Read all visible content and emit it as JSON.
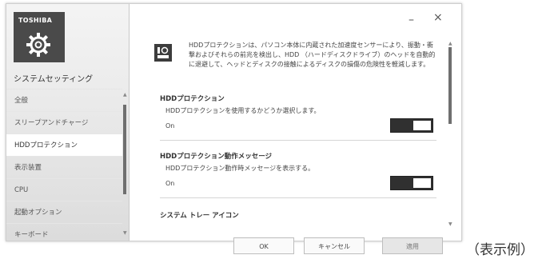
{
  "sidebar": {
    "brand": "TOSHIBA",
    "app_name": "システムセッティング",
    "items": [
      {
        "label": "全般"
      },
      {
        "label": "スリープアンドチャージ"
      },
      {
        "label": "HDDプロテクション",
        "selected": true
      },
      {
        "label": "表示装置"
      },
      {
        "label": "CPU"
      },
      {
        "label": "起動オプション"
      },
      {
        "label": "キーボード"
      }
    ]
  },
  "window_controls": {
    "minimize": "–",
    "close": "×"
  },
  "main": {
    "description": "HDDプロテクションは、パソコン本体に内蔵された加速度センサーにより、振動・衝撃およびそれらの前兆を検出し、HDD （ハードディスクドライブ）のヘッドを自動的に退避して、ヘッドとディスクの接触によるディスクの損傷の危険性を軽減します。",
    "sections": [
      {
        "title": "HDDプロテクション",
        "desc": "HDDプロテクションを使用するかどうか選択します。",
        "state": "On",
        "toggle_on": true
      },
      {
        "title": "HDDプロテクション動作メッセージ",
        "desc": "HDDプロテクション動作時メッセージを表示する。",
        "state": "On",
        "toggle_on": true
      },
      {
        "title": "システム トレー アイコン"
      }
    ]
  },
  "buttons": {
    "ok": "OK",
    "cancel": "キャンセル",
    "apply": "適用"
  },
  "caption": "（表示例）"
}
